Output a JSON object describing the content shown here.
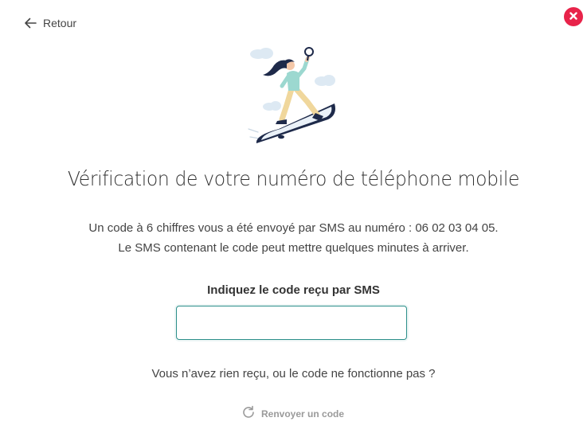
{
  "header": {
    "back_label": "Retour",
    "back_icon": "arrow-left-icon",
    "close_icon": "close-icon",
    "close_color": "#e8234a"
  },
  "illustration": {
    "name": "woman-surfing-phone-illustration"
  },
  "main": {
    "title": "Vérification de votre numéro de téléphone mobile",
    "info_line1": "Un code à 6 chiffres vous a été envoyé par SMS au numéro : 06 02 03 04 05.",
    "info_line2": "Le SMS contenant le code peut mettre quelques minutes à arriver.",
    "code_label": "Indiquez le code reçu par SMS",
    "code_value": "",
    "not_received_text": "Vous n’avez rien reçu, ou le code ne fonctionne pas ?",
    "resend_label": "Renvoyer un code",
    "resend_icon": "refresh-icon",
    "input_border_color": "#2c8f8a"
  }
}
